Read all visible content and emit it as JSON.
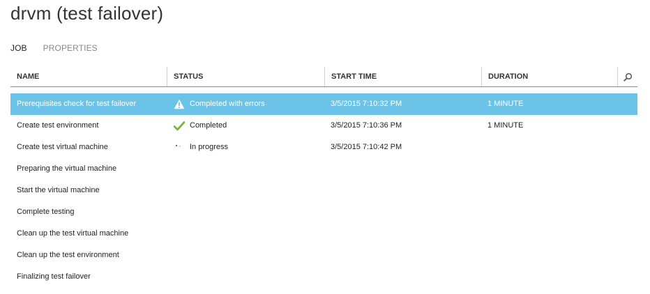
{
  "page": {
    "title": "drvm (test failover)"
  },
  "tabs": [
    {
      "label": "JOB",
      "active": true
    },
    {
      "label": "PROPERTIES",
      "active": false
    }
  ],
  "table": {
    "columns": [
      "NAME",
      "STATUS",
      "START TIME",
      "DURATION"
    ],
    "search_icon": "search-icon",
    "rows": [
      {
        "name": "Prerequisites check for test failover",
        "status": "Completed with errors",
        "status_icon": "warning-icon",
        "start_time": "3/5/2015 7:10:32 PM",
        "duration": "1 MINUTE",
        "selected": true
      },
      {
        "name": "Create test environment",
        "status": "Completed",
        "status_icon": "checkmark-icon",
        "start_time": "3/5/2015 7:10:36 PM",
        "duration": "1 MINUTE",
        "selected": false
      },
      {
        "name": "Create test virtual machine",
        "status": "In progress",
        "status_icon": "progress-dots-icon",
        "start_time": "3/5/2015 7:10:42 PM",
        "duration": "",
        "selected": false
      },
      {
        "name": "Preparing the virtual machine",
        "status": "",
        "status_icon": "",
        "start_time": "",
        "duration": "",
        "selected": false
      },
      {
        "name": "Start the virtual machine",
        "status": "",
        "status_icon": "",
        "start_time": "",
        "duration": "",
        "selected": false
      },
      {
        "name": "Complete testing",
        "status": "",
        "status_icon": "",
        "start_time": "",
        "duration": "",
        "selected": false
      },
      {
        "name": "Clean up the test virtual machine",
        "status": "",
        "status_icon": "",
        "start_time": "",
        "duration": "",
        "selected": false
      },
      {
        "name": "Clean up the test environment",
        "status": "",
        "status_icon": "",
        "start_time": "",
        "duration": "",
        "selected": false
      },
      {
        "name": "Finalizing test failover",
        "status": "",
        "status_icon": "",
        "start_time": "",
        "duration": "",
        "selected": false
      }
    ]
  },
  "colors": {
    "selected_row": "#6cc3e8",
    "check_green": "#7cb342",
    "header_rule": "#8a8a8a"
  }
}
